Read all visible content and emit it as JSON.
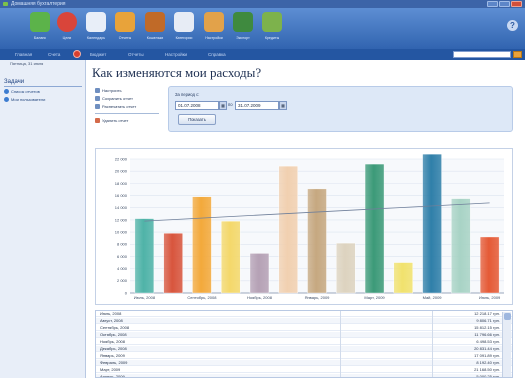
{
  "window": {
    "title": "Домашняя бухгалтерия"
  },
  "toolbar": {
    "items": [
      {
        "label": "Баланс",
        "icon": "money-bag-icon",
        "color": "#5cb34a"
      },
      {
        "label": "Цели",
        "icon": "target-icon",
        "color": "#d9453a"
      },
      {
        "label": "Календарь",
        "icon": "calendar-icon",
        "color": "#e8eef8"
      },
      {
        "label": "Отчеты",
        "icon": "report-icon",
        "color": "#e8a33a"
      },
      {
        "label": "Кошельки",
        "icon": "wallet-icon",
        "color": "#c06a28"
      },
      {
        "label": "Категории",
        "icon": "categories-icon",
        "color": "#e7ecf5"
      },
      {
        "label": "Настройки",
        "icon": "settings-icon",
        "color": "#e2a24a"
      },
      {
        "label": "Экспорт",
        "icon": "export-icon",
        "color": "#3f8a3f"
      },
      {
        "label": "Кредиты",
        "icon": "credit-icon",
        "color": "#7db24c"
      }
    ]
  },
  "tabs": [
    "Главная",
    "Счета",
    "Бюджет",
    "Отчеты",
    "Настройки",
    "Справка"
  ],
  "sidebar": {
    "date": "Пятница, 31 июля",
    "heading": "Задачи",
    "items": [
      "Список отчетов",
      "Мои пользователи"
    ]
  },
  "page": {
    "title": "Как изменяются мои расходы?"
  },
  "actions": [
    "Настроить",
    "Сохранить отчет",
    "Распечатать отчет",
    "Удалить отчет"
  ],
  "period": {
    "label": "За период с:",
    "from": "01.07.2008",
    "to_label": "по",
    "to": "31.07.2009",
    "button": "Показать"
  },
  "chart_data": {
    "type": "bar",
    "categories": [
      "Июль, 2008",
      "Август, 2008",
      "Сентябрь, 2008",
      "Октябрь, 2008",
      "Ноябрь, 2008",
      "Декабрь, 2008",
      "Январь, 2009",
      "Февраль, 2009",
      "Март, 2009",
      "Апрель, 2009",
      "Май, 2009",
      "Июнь, 2009",
      "Июль, 2009"
    ],
    "x_tick_labels": [
      "Июль, 2008",
      "Сентябрь, 2008",
      "Ноябрь, 2008",
      "Январь, 2009",
      "Март, 2009",
      "Май, 2009",
      "Июль, 2009"
    ],
    "values": [
      12218,
      9807,
      15813,
      11797,
      6500,
      20832,
      17092,
      8193,
      21168,
      5000,
      22800,
      15500,
      9200
    ],
    "trend": [
      11800,
      14800
    ],
    "ylim": [
      0,
      22000
    ],
    "yticks": [
      0,
      2000,
      4000,
      6000,
      8000,
      10000,
      12000,
      14000,
      16000,
      18000,
      20000,
      22000
    ],
    "ytick_labels": [
      "0",
      "2 000",
      "4 000",
      "6 000",
      "8 000",
      "10 000",
      "12 000",
      "14 000",
      "16 000",
      "18 000",
      "20 000",
      "22 000"
    ],
    "bar_colors": [
      "#4fb3a8",
      "#d8553d",
      "#f3a93b",
      "#f4d86a",
      "#b5a1b5",
      "#f1d0b0",
      "#c6a880",
      "#ddd3bf",
      "#3c9a78",
      "#f1e26d",
      "#2f7fa9",
      "#a8d3c5",
      "#e55a36"
    ],
    "grid": true,
    "title": "",
    "xlabel": "",
    "ylabel": ""
  },
  "table": {
    "rows": [
      {
        "name": "Июль, 2008",
        "value": "12 218.17 грн."
      },
      {
        "name": "Август, 2008",
        "value": "9 806.71 грн."
      },
      {
        "name": "Сентябрь, 2008",
        "value": "15 812.15 грн."
      },
      {
        "name": "Октябрь, 2008",
        "value": "11 796.66 грн."
      },
      {
        "name": "Ноябрь, 2008",
        "value": "6 498.53 грн."
      },
      {
        "name": "Декабрь, 2008",
        "value": "20 831.44 грн."
      },
      {
        "name": "Январь, 2009",
        "value": "17 091.89 грн."
      },
      {
        "name": "Февраль, 2009",
        "value": "8 192.40 грн."
      },
      {
        "name": "Март, 2009",
        "value": "21 168.50 грн."
      },
      {
        "name": "Апрель, 2009",
        "value": "5 000.25 грн."
      }
    ]
  }
}
